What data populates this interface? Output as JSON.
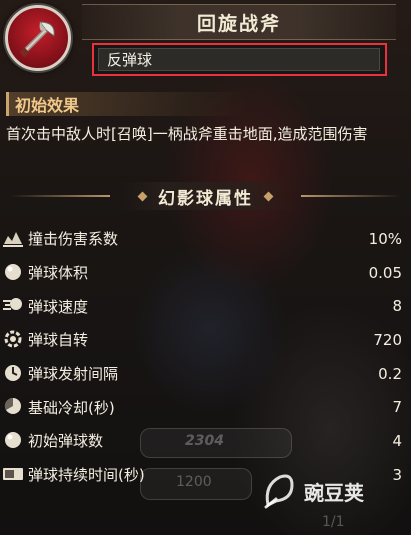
{
  "header": {
    "title": "回旋战斧",
    "subtitle": "反弹球",
    "skill_icon": "axe-icon"
  },
  "initial_effect": {
    "heading": "初始效果",
    "description": "首次击中敌人时[召唤]一柄战斧重击地面,造成范围伤害"
  },
  "attributes": {
    "heading": "幻影球属性",
    "rows": [
      {
        "label": "撞击伤害系数",
        "value": "10%",
        "icon": "damage-icon"
      },
      {
        "label": "弹球体积",
        "value": "0.05",
        "icon": "ball-size-icon"
      },
      {
        "label": "弹球速度",
        "value": "8",
        "icon": "ball-speed-icon"
      },
      {
        "label": "弹球自转",
        "value": "720",
        "icon": "ball-spin-icon"
      },
      {
        "label": "弹球发射间隔",
        "value": "0.2",
        "icon": "launch-interval-icon"
      },
      {
        "label": "基础冷却(秒)",
        "value": "7",
        "icon": "cooldown-icon"
      },
      {
        "label": "初始弹球数",
        "value": "4",
        "icon": "ball-count-icon"
      },
      {
        "label": "弹球持续时间(秒)",
        "value": "3",
        "icon": "duration-icon"
      }
    ]
  },
  "background": {
    "ghost_power": "2304",
    "ghost_gold": "1200",
    "ghost_page": "1/1"
  },
  "watermark": {
    "text": "豌豆荚"
  },
  "colors": {
    "highlight_border": "#e8323d",
    "section_accent": "#f0c98b"
  }
}
